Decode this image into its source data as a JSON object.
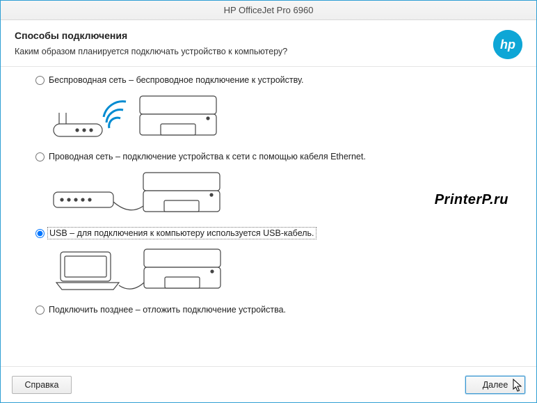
{
  "window": {
    "title": "HP OfficeJet Pro 6960"
  },
  "header": {
    "heading": "Способы подключения",
    "subheading": "Каким образом планируется подключать устройство к компьютеру?"
  },
  "options": {
    "wireless": {
      "label": "Беспроводная сеть – беспроводное подключение к устройству."
    },
    "wired": {
      "label": "Проводная сеть – подключение устройства к сети с помощью кабеля Ethernet."
    },
    "usb": {
      "label": "USB – для подключения к компьютеру используется USB-кабель."
    },
    "later": {
      "label": "Подключить позднее – отложить подключение устройства."
    }
  },
  "footer": {
    "help": "Справка",
    "next": "Далее"
  },
  "watermark": "PrinterP.ru",
  "logo_alt": "hp"
}
